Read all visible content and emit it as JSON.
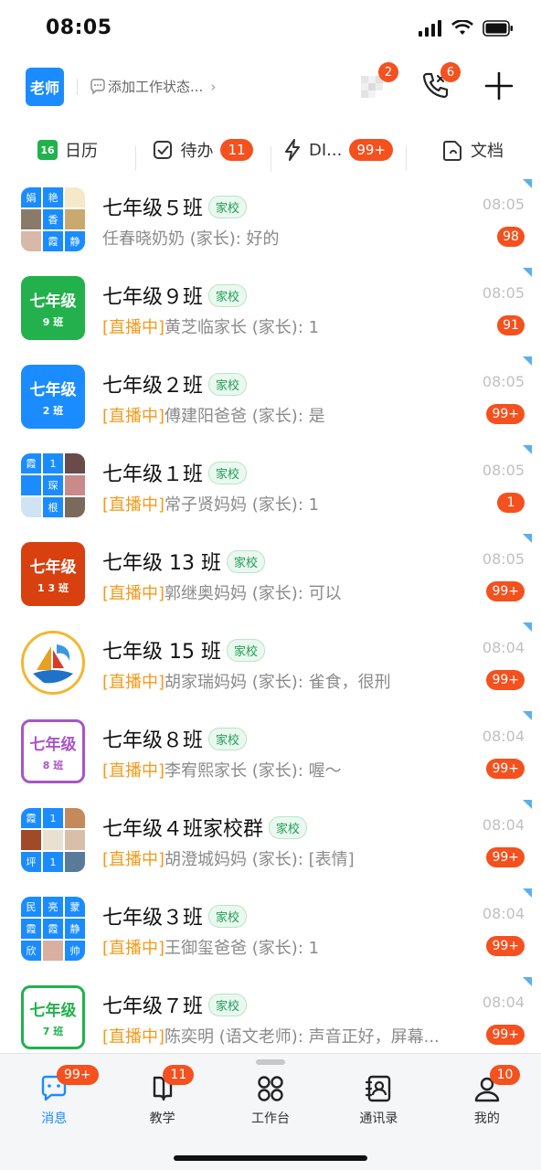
{
  "status_bar": {
    "time": "08:05"
  },
  "header": {
    "role_label": "老师",
    "status_prompt": "添加工作状态...",
    "icon_badge_1": "2",
    "call_badge": "6"
  },
  "shortcuts": [
    {
      "label": "日历",
      "icon": "calendar-icon",
      "icon_text": "16"
    },
    {
      "label": "待办",
      "icon": "checkbox-icon",
      "badge": "11"
    },
    {
      "label": "DI...",
      "icon": "lightning-icon",
      "badge": "99+"
    },
    {
      "label": "文档",
      "icon": "document-icon"
    }
  ],
  "chats": [
    {
      "title": "七年级５班",
      "tag": "家校",
      "live": "",
      "preview": "任春晓奶奶 (家长): 好的",
      "time": "08:05",
      "unread": "98",
      "avatar": {
        "cells": [
          "娟",
          "艳",
          "",
          "",
          "香",
          "",
          "",
          "霞",
          "静"
        ]
      }
    },
    {
      "title": "七年级９班",
      "tag": "家校",
      "live": "[直播中]",
      "preview": "黄芝临家长 (家长): 1",
      "time": "08:05",
      "unread": "91",
      "avatar": {
        "big": "七年级",
        "small": "9 班"
      }
    },
    {
      "title": "七年级２班",
      "tag": "家校",
      "live": "[直播中]",
      "preview": "傅建阳爸爸 (家长): 是",
      "time": "08:05",
      "unread": "99+",
      "avatar": {
        "big": "七年级",
        "small": "2 班"
      }
    },
    {
      "title": "七年级１班",
      "tag": "家校",
      "live": "[直播中]",
      "preview": "常子贤妈妈 (家长): 1",
      "time": "08:05",
      "unread": "1",
      "avatar": {
        "cells": [
          "霞",
          "1",
          "",
          "",
          "琛",
          "",
          "",
          "根",
          ""
        ]
      }
    },
    {
      "title": "七年级 13 班",
      "tag": "家校",
      "live": "[直播中]",
      "preview": "郭继奥妈妈 (家长): 可以",
      "time": "08:05",
      "unread": "99+",
      "avatar": {
        "big": "七年级",
        "small": "1 3 班"
      }
    },
    {
      "title": "七年级 15 班",
      "tag": "家校",
      "live": "[直播中]",
      "preview": "胡家瑞妈妈 (家长): 雀食，很刑",
      "time": "08:04",
      "unread": "99+",
      "avatar": {}
    },
    {
      "title": "七年级８班",
      "tag": "家校",
      "live": "[直播中]",
      "preview": "李宥熙家长 (家长): 喔～",
      "time": "08:04",
      "unread": "99+",
      "avatar": {
        "big": "七年级",
        "small": "8 班"
      }
    },
    {
      "title": "七年级４班家校群",
      "tag": "家校",
      "live": "[直播中]",
      "preview": "胡澄城妈妈 (家长): [表情]",
      "time": "08:04",
      "unread": "99+",
      "avatar": {
        "cells": [
          "霞",
          "1",
          "",
          "",
          "",
          "",
          "坪",
          "1",
          ""
        ]
      }
    },
    {
      "title": "七年级３班",
      "tag": "家校",
      "live": "[直播中]",
      "preview": "王御玺爸爸 (家长): 1",
      "time": "08:04",
      "unread": "99+",
      "avatar": {
        "cells": [
          "民",
          "亮",
          "蒙",
          "霞",
          "霞",
          "静",
          "欣",
          "",
          "帅"
        ]
      }
    },
    {
      "title": "七年级７班",
      "tag": "家校",
      "live": "[直播中]",
      "preview": "陈奕明 (语文老师): 声音正好，屏幕...",
      "time": "08:04",
      "unread": "99+",
      "avatar": {
        "big": "七年级",
        "small": "7 班"
      }
    }
  ],
  "bottom_nav": [
    {
      "label": "消息",
      "icon": "message-icon",
      "badge": "99+",
      "active": true
    },
    {
      "label": "教学",
      "icon": "book-icon",
      "badge": "11"
    },
    {
      "label": "工作台",
      "icon": "workbench-icon"
    },
    {
      "label": "通讯录",
      "icon": "contacts-icon"
    },
    {
      "label": "我的",
      "icon": "profile-icon",
      "badge": "10"
    }
  ],
  "colors": {
    "accent": "#1a8cff",
    "badge": "#f4511e",
    "live": "#f39a19",
    "tag_green": "#1f9d57"
  }
}
